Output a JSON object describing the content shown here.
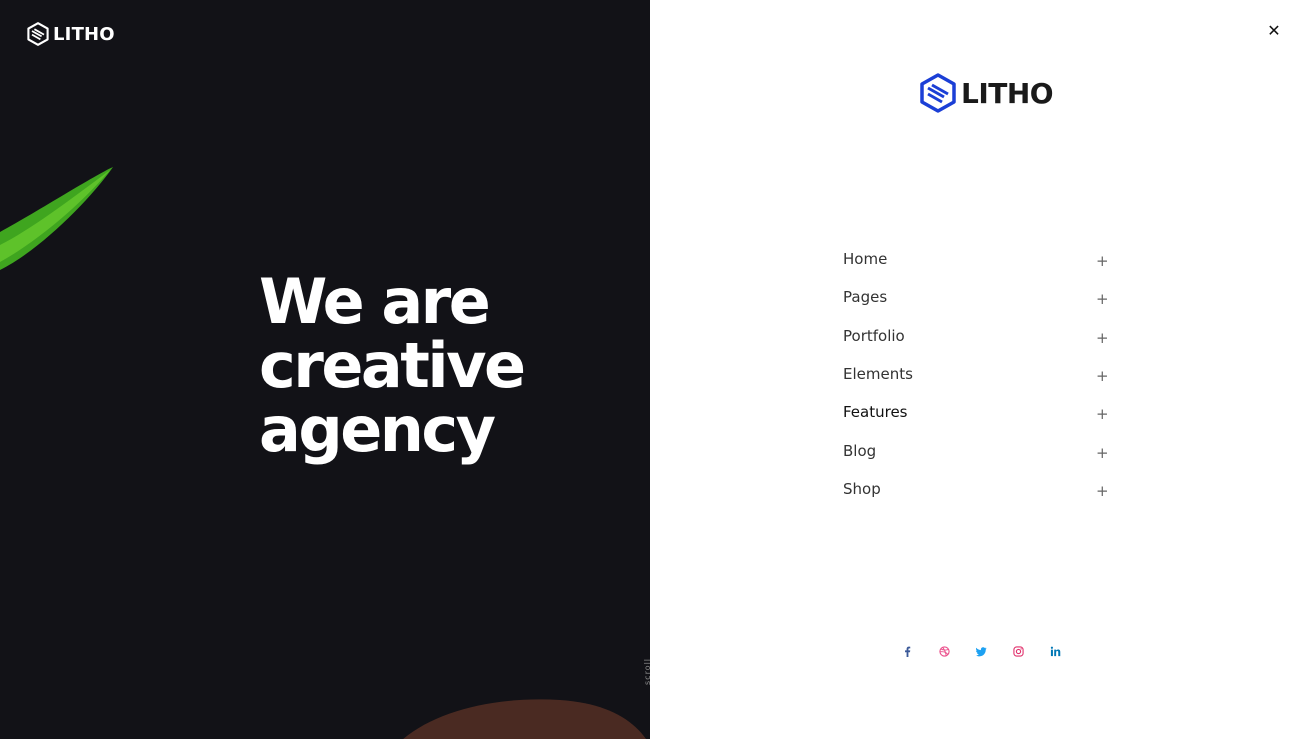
{
  "brand": {
    "name": "LITHO",
    "accent_color": "#1b3fd6"
  },
  "hero": {
    "headline_lines": [
      "We are",
      "creative",
      "agency"
    ],
    "scroll_label": "scroll"
  },
  "menu": {
    "items": [
      {
        "label": "Home",
        "icon": "plus-icon"
      },
      {
        "label": "Pages",
        "icon": "plus-icon"
      },
      {
        "label": "Portfolio",
        "icon": "plus-icon"
      },
      {
        "label": "Elements",
        "icon": "plus-icon"
      },
      {
        "label": "Features",
        "icon": "plus-icon"
      },
      {
        "label": "Blog",
        "icon": "plus-icon"
      },
      {
        "label": "Shop",
        "icon": "plus-icon"
      }
    ],
    "plus_glyph": "+",
    "close_glyph": "✕"
  },
  "social": [
    {
      "name": "facebook-icon",
      "color": "#3b5998"
    },
    {
      "name": "dribbble-icon",
      "color": "#ea4c89"
    },
    {
      "name": "twitter-icon",
      "color": "#1da1f2"
    },
    {
      "name": "instagram-icon",
      "color": "#e1306c"
    },
    {
      "name": "linkedin-icon",
      "color": "#0077b5"
    }
  ]
}
